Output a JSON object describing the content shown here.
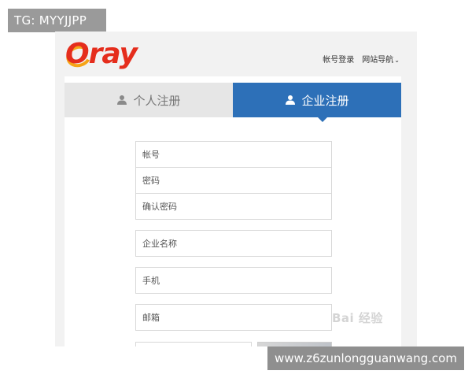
{
  "watermark_top": "TG: MYYJJPP",
  "header": {
    "logo_text": "Oray",
    "nav": {
      "account_login": "帐号登录",
      "site_nav": "网站导航"
    }
  },
  "tabs": [
    {
      "label": "个人注册",
      "icon": "person-icon",
      "active": false
    },
    {
      "label": "企业注册",
      "icon": "person-icon",
      "active": true
    }
  ],
  "form": {
    "account_placeholder": "帐号",
    "password_placeholder": "密码",
    "confirm_placeholder": "确认密码",
    "company_placeholder": "企业名称",
    "mobile_placeholder": "手机",
    "email_placeholder": "邮箱"
  },
  "colors": {
    "active_tab": "#2d70b8",
    "inactive_tab": "#e6e6e6",
    "logo": "#e52d1c"
  },
  "watermark_baidu": "Bai 经验",
  "watermark_bottom": "www.z6zunlongguanwang.com"
}
